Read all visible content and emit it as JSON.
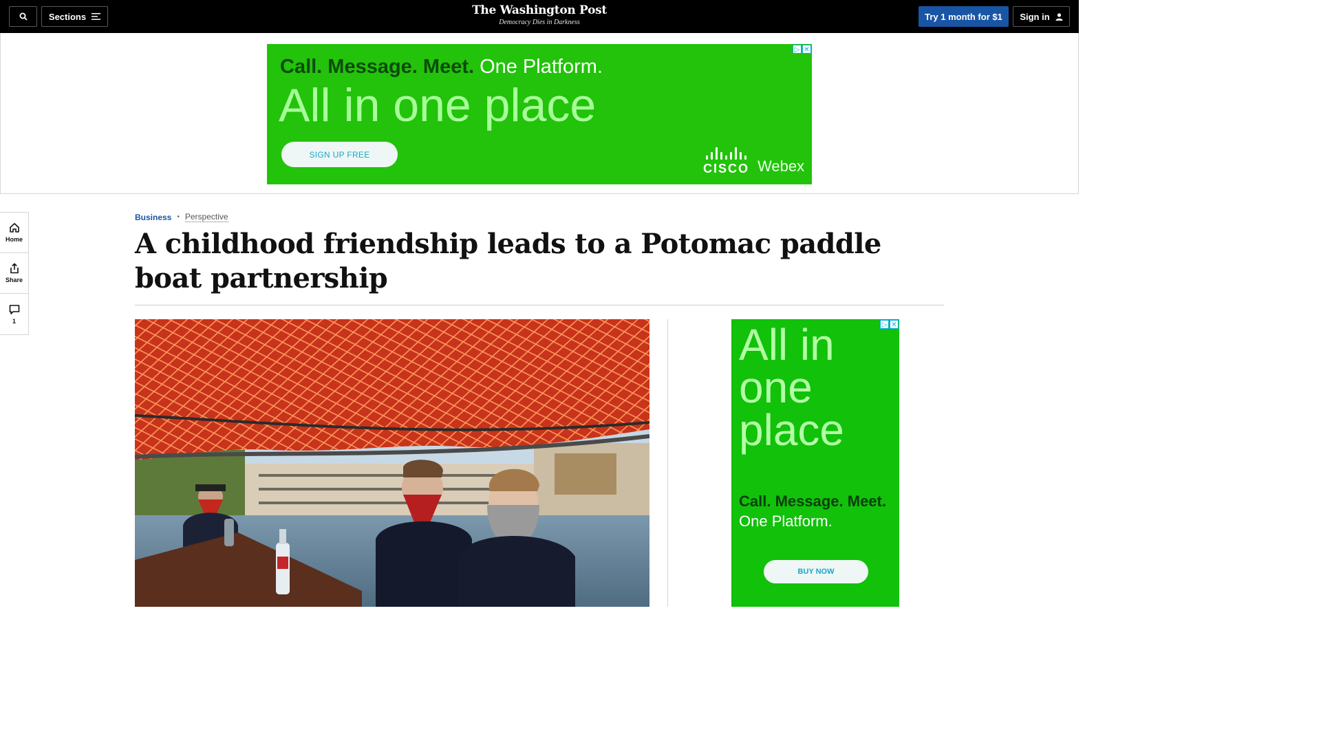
{
  "header": {
    "sections_label": "Sections",
    "logo_text": "The Washington Post",
    "tagline": "Democracy Dies in Darkness",
    "subscribe_label": "Try 1 month for $1",
    "signin_label": "Sign in",
    "icons": [
      "search-icon",
      "menu-icon",
      "user-icon"
    ]
  },
  "top_ad": {
    "line1_bold": "Call. Message. Meet.",
    "line1_light": "One Platform.",
    "headline": "All in one place",
    "cta": "SIGN UP FREE",
    "brand_cisco": "CISCO",
    "brand_webex": "Webex",
    "color": "#22c30a"
  },
  "rail": {
    "home_label": "Home",
    "share_label": "Share",
    "comments_count": "1"
  },
  "article": {
    "section": "Business",
    "label": "Perspective",
    "headline": "A childhood friendship leads to a Potomac paddle boat partnership",
    "accent_color": "#1955a5"
  },
  "side_ad": {
    "headline": "All in one place",
    "line1": "Call. Message. Meet.",
    "line2": "One Platform.",
    "cta": "BUY NOW"
  }
}
